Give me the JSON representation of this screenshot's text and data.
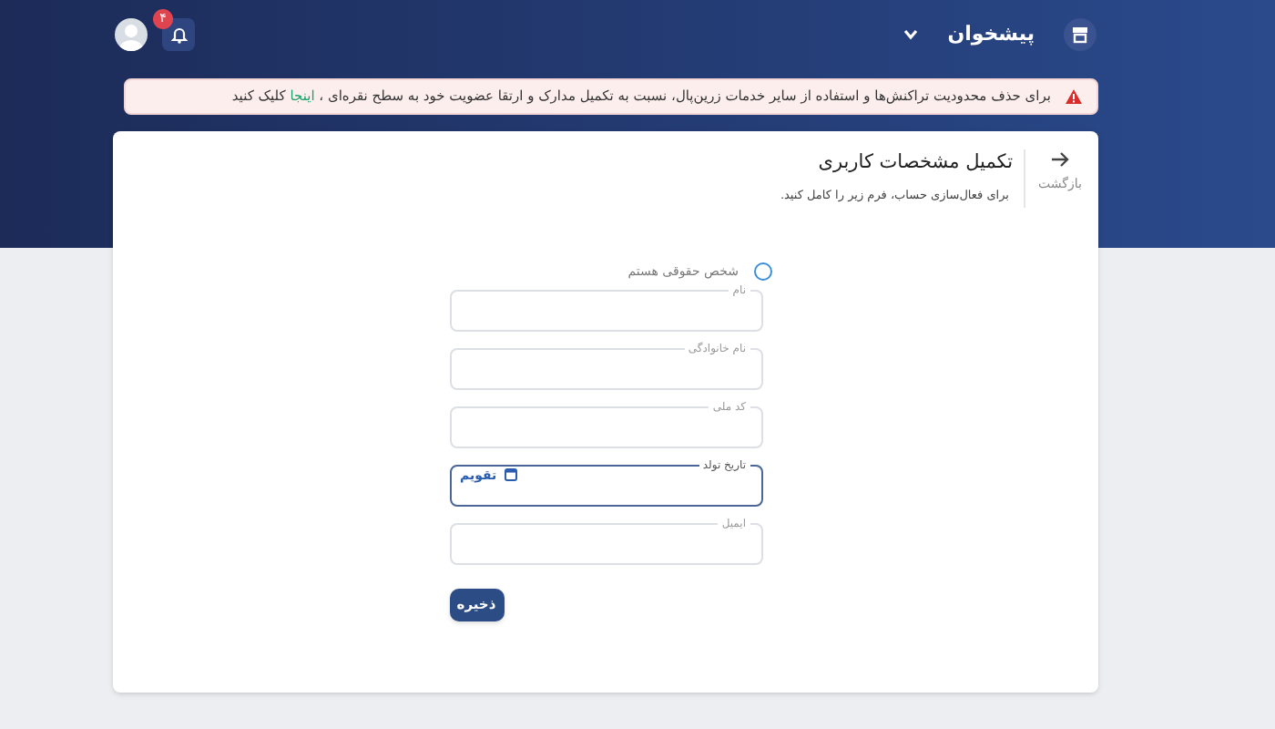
{
  "topbar": {
    "menu_label": "پیشخوان",
    "notification_count": "۴"
  },
  "alert": {
    "text_before": "برای حذف محدودیت تراکنش‌ها و استفاده از سایر خدمات زرین‌پال، نسبت به تکمیل مدارک و ارتقا عضویت خود به سطح نقره‌ای ،",
    "link": "اینجا",
    "text_after": "کلیک کنید"
  },
  "page": {
    "back_label": "بازگشت",
    "title": "تکمیل مشخصات کاربری",
    "subtitle": "برای فعال‌سازی حساب، فرم زیر را کامل کنید."
  },
  "legal_entity": {
    "label": "شخص حقوقی هستم",
    "checked": false
  },
  "fields": [
    {
      "kind": "text",
      "label": "نام",
      "focused": false
    },
    {
      "kind": "text",
      "label": "نام خانوادگی",
      "focused": false
    },
    {
      "kind": "text",
      "label": "کد ملی",
      "focused": false
    },
    {
      "kind": "date",
      "label": "تاریخ تولد",
      "focused": true,
      "button": "تقویم"
    },
    {
      "kind": "text",
      "label": "ایمیل",
      "focused": false
    }
  ],
  "save_button": "ذخیره"
}
